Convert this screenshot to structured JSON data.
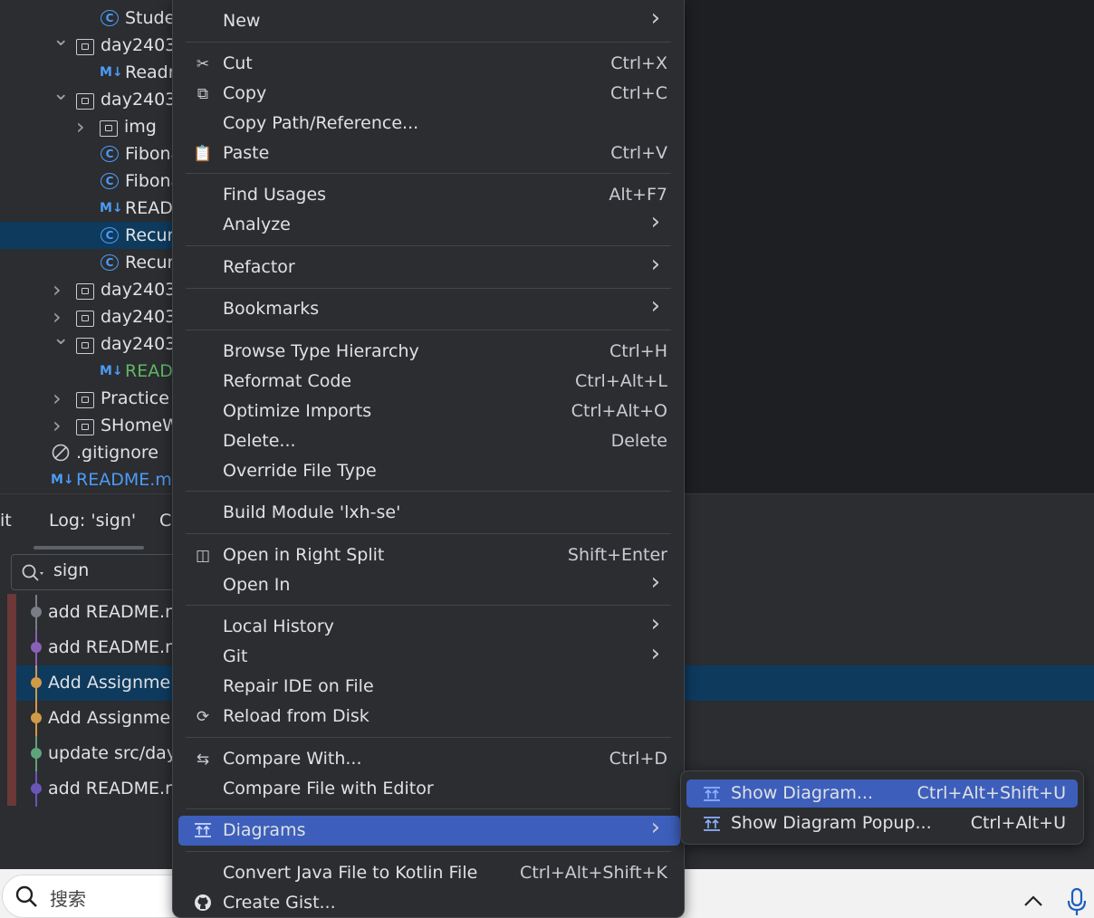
{
  "tree": {
    "rows": [
      {
        "label": "Stude",
        "kind": "class",
        "indent": 3
      },
      {
        "label": "day2403",
        "kind": "folder",
        "indent": 2,
        "chev": "v"
      },
      {
        "label": "Readr",
        "kind": "md",
        "indent": 3
      },
      {
        "label": "day2403",
        "kind": "folder",
        "indent": 2,
        "chev": "v"
      },
      {
        "label": "img",
        "kind": "folder",
        "indent": 3,
        "chev": ">"
      },
      {
        "label": "Fibona",
        "kind": "class",
        "indent": 3
      },
      {
        "label": "Fibona",
        "kind": "class",
        "indent": 3
      },
      {
        "label": "READ",
        "kind": "md",
        "indent": 3
      },
      {
        "label": "Recur",
        "kind": "class",
        "indent": 3,
        "selected": true
      },
      {
        "label": "Recur",
        "kind": "class",
        "indent": 3
      },
      {
        "label": "day2403",
        "kind": "folder",
        "indent": 2,
        "chev": ">"
      },
      {
        "label": "day2403",
        "kind": "folder",
        "indent": 2,
        "chev": ">"
      },
      {
        "label": "day2403",
        "kind": "folder",
        "indent": 2,
        "chev": "v"
      },
      {
        "label": "READ",
        "kind": "md",
        "indent": 3,
        "green": true
      },
      {
        "label": "Practice",
        "kind": "folder",
        "indent": 2,
        "chev": ">"
      },
      {
        "label": "SHomeW",
        "kind": "folder",
        "indent": 2,
        "chev": ">"
      },
      {
        "label": ".gitignore",
        "kind": "ignore",
        "indent": 1
      },
      {
        "label": "README.md",
        "kind": "md",
        "indent": 0,
        "blue": true
      }
    ]
  },
  "bottom": {
    "tab_git": "it",
    "tab_log": "Log: 'sign'",
    "tab_c": "C",
    "search_value": "sign",
    "log": [
      {
        "label": "add README.m",
        "color": "#7a7d85"
      },
      {
        "label": "add README.m",
        "color": "#8a5fb8"
      },
      {
        "label": "Add Assignmer",
        "color": "#d19a48",
        "selected": true
      },
      {
        "label": "Add Assignmer",
        "color": "#d19a48"
      },
      {
        "label": "update src/day",
        "color": "#5fa37a"
      },
      {
        "label": "add README.m",
        "color": "#6a55b8"
      }
    ]
  },
  "menu": {
    "items": [
      {
        "label": "New",
        "arrow": true
      },
      {
        "label": "Cut",
        "shortcut": "Ctrl+X",
        "icon": "scissors-icon",
        "glyph": "✂"
      },
      {
        "label": "Copy",
        "shortcut": "Ctrl+C",
        "icon": "copy-icon",
        "glyph": "⧉"
      },
      {
        "label": "Copy Path/Reference..."
      },
      {
        "label": "Paste",
        "shortcut": "Ctrl+V",
        "icon": "paste-icon",
        "glyph": "📋"
      },
      {
        "label": "Find Usages",
        "shortcut": "Alt+F7"
      },
      {
        "label": "Analyze",
        "arrow": true
      },
      {
        "label": "Refactor",
        "arrow": true
      },
      {
        "label": "Bookmarks",
        "arrow": true
      },
      {
        "label": "Browse Type Hierarchy",
        "shortcut": "Ctrl+H"
      },
      {
        "label": "Reformat Code",
        "shortcut": "Ctrl+Alt+L"
      },
      {
        "label": "Optimize Imports",
        "shortcut": "Ctrl+Alt+O"
      },
      {
        "label": "Delete...",
        "shortcut": "Delete"
      },
      {
        "label": "Override File Type"
      },
      {
        "label": "Build Module 'lxh-se'"
      },
      {
        "label": "Open in Right Split",
        "shortcut": "Shift+Enter",
        "icon": "split-icon",
        "glyph": "◫"
      },
      {
        "label": "Open In",
        "arrow": true
      },
      {
        "label": "Local History",
        "arrow": true
      },
      {
        "label": "Git",
        "arrow": true
      },
      {
        "label": "Repair IDE on File"
      },
      {
        "label": "Reload from Disk",
        "icon": "reload-icon",
        "glyph": "⟳"
      },
      {
        "label": "Compare With...",
        "shortcut": "Ctrl+D",
        "icon": "compare-icon",
        "glyph": "⇆"
      },
      {
        "label": "Compare File with Editor"
      },
      {
        "label": "Diagrams",
        "arrow": true,
        "active": true,
        "icon": "diagram-icon"
      },
      {
        "label": "Convert Java File to Kotlin File",
        "shortcut": "Ctrl+Alt+Shift+K"
      },
      {
        "label": "Create Gist...",
        "icon": "github-icon",
        "glyph": "●"
      }
    ]
  },
  "submenu": {
    "items": [
      {
        "label": "Show Diagram...",
        "shortcut": "Ctrl+Alt+Shift+U",
        "active": true
      },
      {
        "label": "Show Diagram Popup...",
        "shortcut": "Ctrl+Alt+U"
      }
    ]
  },
  "taskbar": {
    "search_placeholder": "搜索"
  }
}
